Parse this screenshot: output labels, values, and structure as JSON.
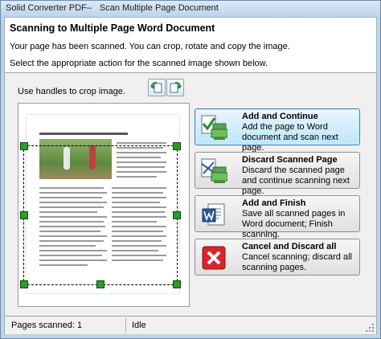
{
  "window": {
    "app_name": "Solid Converter PDF",
    "title": "Scan Multiple Page Document"
  },
  "header": {
    "title": "Scanning to Multiple Page Word Document",
    "description": "Your page has been scanned. You can crop, rotate and copy the image.",
    "instruction": "Select the appropriate action for the scanned image shown below."
  },
  "preview": {
    "label": "Use handles to crop image.",
    "rotate_left_icon": "rotate-left-icon",
    "rotate_right_icon": "rotate-right-icon"
  },
  "actions": [
    {
      "title": "Add and Continue",
      "description": "Add the page to Word document and scan next page.",
      "icon": "add-page-icon",
      "selected": true
    },
    {
      "title": "Discard Scanned Page",
      "description": "Discard the scanned page and continue scanning next page.",
      "icon": "discard-page-icon",
      "selected": false
    },
    {
      "title": "Add and Finish",
      "description": "Save all scanned pages in Word document; Finish scanning.",
      "icon": "word-document-icon",
      "selected": false
    },
    {
      "title": "Cancel and Discard all",
      "description": "Cancel scanning; discard all scanning pages.",
      "icon": "cancel-icon",
      "selected": false
    }
  ],
  "status": {
    "pages_scanned": "Pages scanned: 1",
    "state": "Idle"
  },
  "colors": {
    "frame": "#bcd3ea",
    "selected_action": "#bee6fd",
    "handle_green": "#2c9a2c",
    "cancel_red": "#d9242b",
    "word_blue": "#2b5797"
  }
}
